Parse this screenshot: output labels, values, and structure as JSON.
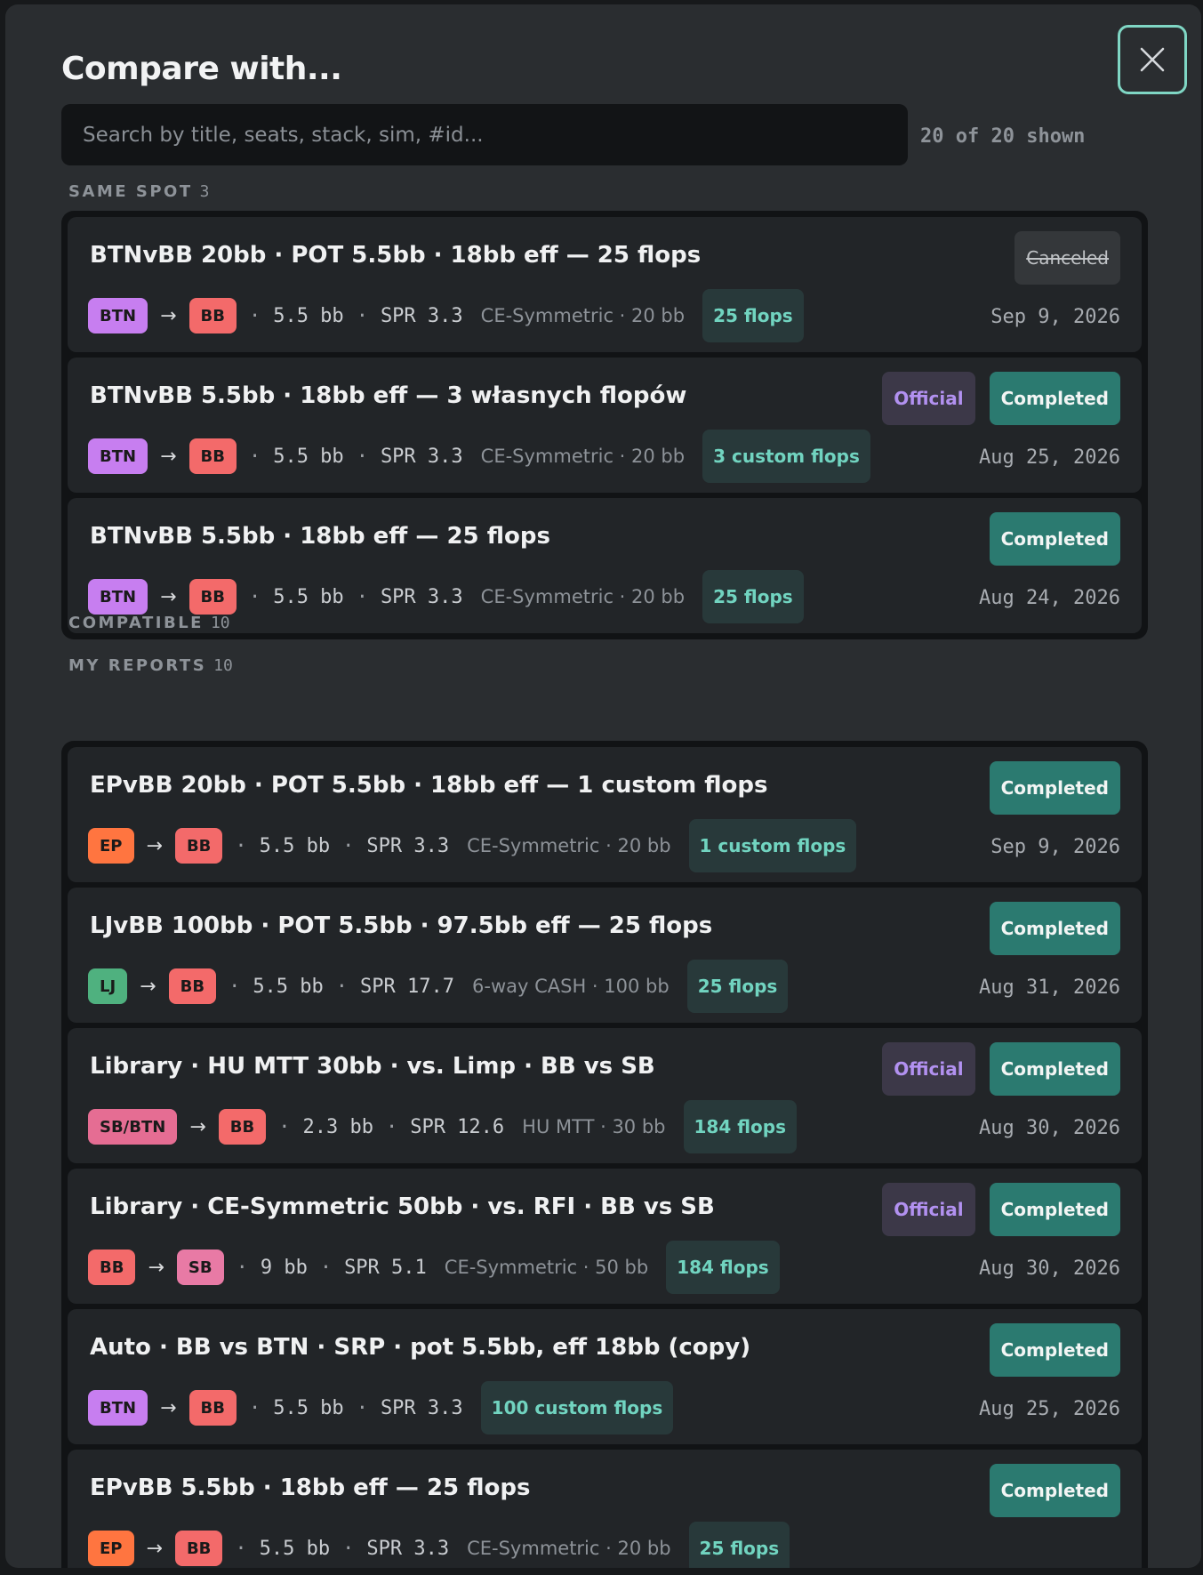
{
  "title": "Compare with...",
  "search": {
    "placeholder": "Search by title, seats, stack, sim, #id...",
    "value": ""
  },
  "shown_count": "20 of 20 shown",
  "sections": {
    "same_spot": {
      "label": "SAME SPOT",
      "count": "3"
    },
    "compatible": {
      "label": "COMPATIBLE",
      "count": "10"
    },
    "my_reports": {
      "label": "MY REPORTS",
      "count": "10"
    }
  },
  "same_spot_cards": [
    {
      "title": "BTNvBB 20bb · POT 5.5bb · 18bb eff — 25 flops",
      "badges": [
        "Canceled"
      ],
      "seat_from": "BTN",
      "seat_to": "BB",
      "pot": "5.5 bb",
      "spr": "SPR 3.3",
      "sim": "CE-Symmetric · 20 bb",
      "flops": "25 flops",
      "date": "Sep 9, 2026"
    },
    {
      "title": "BTNvBB 5.5bb · 18bb eff — 3 własnych flopów",
      "badges": [
        "Official",
        "Completed"
      ],
      "seat_from": "BTN",
      "seat_to": "BB",
      "pot": "5.5 bb",
      "spr": "SPR 3.3",
      "sim": "CE-Symmetric · 20 bb",
      "flops": "3 custom flops",
      "date": "Aug 25, 2026"
    },
    {
      "title": "BTNvBB 5.5bb · 18bb eff — 25 flops",
      "badges": [
        "Completed"
      ],
      "seat_from": "BTN",
      "seat_to": "BB",
      "pot": "5.5 bb",
      "spr": "SPR 3.3",
      "sim": "CE-Symmetric · 20 bb",
      "flops": "25 flops",
      "date": "Aug 24, 2026"
    }
  ],
  "my_reports_cards": [
    {
      "title": "EPvBB 20bb · POT 5.5bb · 18bb eff — 1 custom flops",
      "badges": [
        "Completed"
      ],
      "seat_from": "EP",
      "seat_to": "BB",
      "pot": "5.5 bb",
      "spr": "SPR 3.3",
      "sim": "CE-Symmetric · 20 bb",
      "flops": "1 custom flops",
      "date": "Sep 9, 2026"
    },
    {
      "title": "LJvBB 100bb · POT 5.5bb · 97.5bb eff — 25 flops",
      "badges": [
        "Completed"
      ],
      "seat_from": "LJ",
      "seat_to": "BB",
      "pot": "5.5 bb",
      "spr": "SPR 17.7",
      "sim": "6-way CASH · 100 bb",
      "flops": "25 flops",
      "date": "Aug 31, 2026"
    },
    {
      "title": "Library · HU MTT 30bb · vs. Limp · BB vs SB",
      "badges": [
        "Official",
        "Completed"
      ],
      "seat_from": "SB/BTN",
      "seat_to": "BB",
      "pot": "2.3 bb",
      "spr": "SPR 12.6",
      "sim": "HU MTT · 30 bb",
      "flops": "184 flops",
      "date": "Aug 30, 2026"
    },
    {
      "title": "Library · CE-Symmetric 50bb · vs. RFI · BB vs SB",
      "badges": [
        "Official",
        "Completed"
      ],
      "seat_from": "BB",
      "seat_to": "SB",
      "pot": "9 bb",
      "spr": "SPR 5.1",
      "sim": "CE-Symmetric · 50 bb",
      "flops": "184 flops",
      "date": "Aug 30, 2026"
    },
    {
      "title": "Auto · BB vs BTN · SRP · pot 5.5bb, eff 18bb (copy)",
      "badges": [
        "Completed"
      ],
      "seat_from": "BTN",
      "seat_to": "BB",
      "pot": "5.5 bb",
      "spr": "SPR 3.3",
      "sim": "",
      "flops": "100 custom flops",
      "date": "Aug 25, 2026"
    },
    {
      "title": "EPvBB 5.5bb · 18bb eff — 25 flops",
      "badges": [
        "Completed"
      ],
      "seat_from": "EP",
      "seat_to": "BB",
      "pot": "5.5 bb",
      "spr": "SPR 3.3",
      "sim": "CE-Symmetric · 20 bb",
      "flops": "25 flops",
      "date": ""
    }
  ],
  "colors": {
    "accent": "#7fd6c4",
    "completed": "#2b7a70",
    "official_text": "#b291f0",
    "seat": {
      "BTN": "#c77ef0",
      "BB": "#f36a6a",
      "EP": "#ff7540",
      "LJ": "#4fb17f",
      "SB/BTN": "#e56d93",
      "SB": "#e87aa5"
    }
  },
  "icons": {
    "close": "close-icon",
    "arrow": "arrow-right-icon"
  },
  "arrow_glyph": "→",
  "separator_glyph": "·"
}
